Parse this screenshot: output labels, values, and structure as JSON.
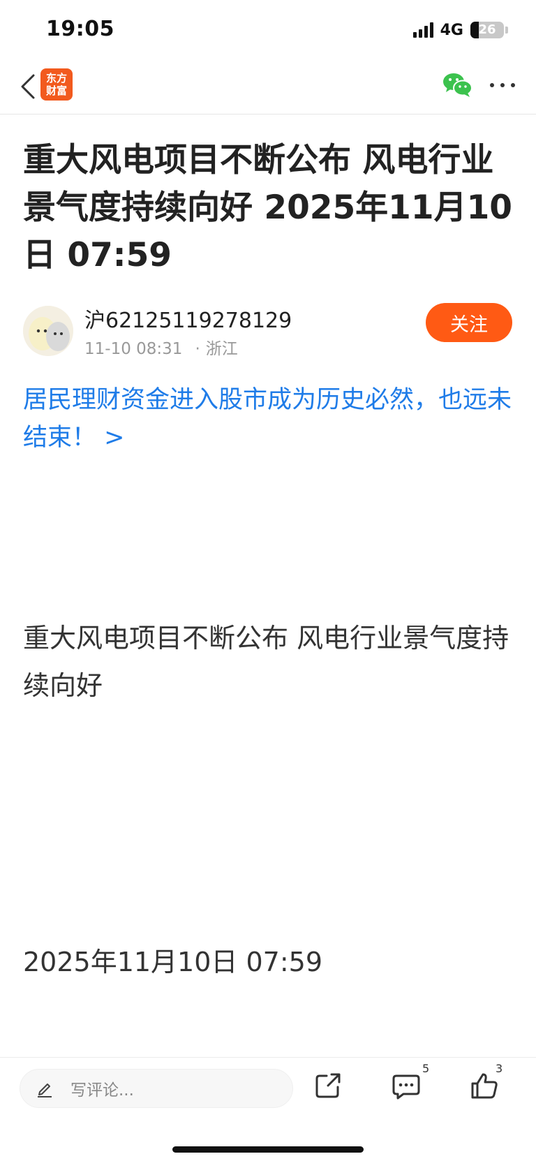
{
  "status_bar": {
    "time": "19:05",
    "network": "4G",
    "battery_level": "26",
    "battery_fraction": 0.26
  },
  "nav": {
    "logo_line1": "东方",
    "logo_line2": "财富",
    "back_icon": "chevron-left-icon",
    "share_wechat_icon": "wechat-icon",
    "more_icon": "more-dots-icon"
  },
  "article": {
    "title": "重大风电项目不断公布 风电行业景气度持续向好 2025年11月10日 07:59",
    "author": {
      "name": "沪62125119278129",
      "time": "11-10 08:31",
      "location": "浙江",
      "follow_label": "关注"
    },
    "promo_link": "居民理财资金进入股市成为历史必然，也远未结束！ >",
    "body": "重大风电项目不断公布 风电行业景气度持续向好",
    "date_line": "2025年11月10日 07:59"
  },
  "bottom_bar": {
    "comment_placeholder": "写评论...",
    "comment_count": "5",
    "like_count": "3"
  },
  "colors": {
    "accent": "#ff5a14",
    "link": "#1f7ce8",
    "logo": "#f25a1e",
    "wechat": "#3cc24e"
  }
}
